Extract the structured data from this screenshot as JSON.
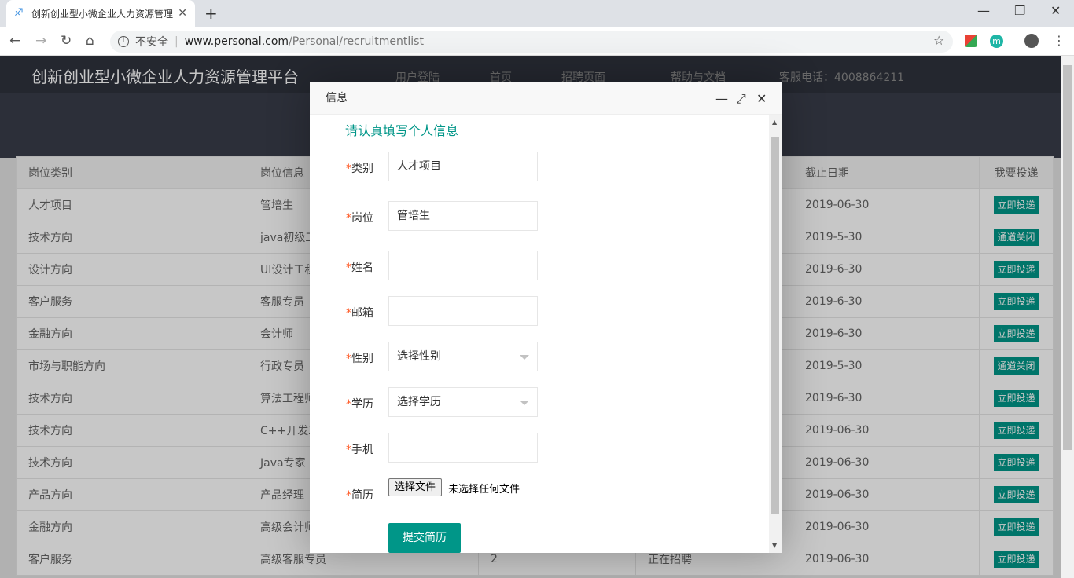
{
  "browser": {
    "tab_title": "创新创业型小微企业人力资源管理",
    "insecure_label": "不安全",
    "url_host": "www.personal.com",
    "url_path": "/Personal/recruitmentlist"
  },
  "site": {
    "brand": "创新创业型小微企业人力资源管理平台",
    "nav": [
      "用户登陆",
      "首页",
      "招聘页面",
      "帮助与文档",
      "客服电话：4008864211"
    ]
  },
  "table": {
    "headers": [
      "岗位类别",
      "岗位信息",
      "",
      "",
      "截止日期",
      "我要投递"
    ],
    "rows": [
      {
        "category": "人才项目",
        "position": "管培生",
        "count": "",
        "status": "",
        "deadline": "2019-06-30",
        "action": "立即投递"
      },
      {
        "category": "技术方向",
        "position": "java初级工",
        "count": "",
        "status": "",
        "deadline": "2019-5-30",
        "action": "通道关闭"
      },
      {
        "category": "设计方向",
        "position": "UI设计工程",
        "count": "",
        "status": "",
        "deadline": "2019-6-30",
        "action": "立即投递"
      },
      {
        "category": "客户服务",
        "position": "客服专员",
        "count": "",
        "status": "",
        "deadline": "2019-6-30",
        "action": "立即投递"
      },
      {
        "category": "金融方向",
        "position": "会计师",
        "count": "",
        "status": "",
        "deadline": "2019-6-30",
        "action": "立即投递"
      },
      {
        "category": "市场与职能方向",
        "position": "行政专员",
        "count": "",
        "status": "",
        "deadline": "2019-5-30",
        "action": "通道关闭"
      },
      {
        "category": "技术方向",
        "position": "算法工程师",
        "count": "",
        "status": "",
        "deadline": "2019-6-30",
        "action": "立即投递"
      },
      {
        "category": "技术方向",
        "position": "C++开发工",
        "count": "",
        "status": "",
        "deadline": "2019-06-30",
        "action": "立即投递"
      },
      {
        "category": "技术方向",
        "position": "Java专家",
        "count": "",
        "status": "",
        "deadline": "2019-06-30",
        "action": "立即投递"
      },
      {
        "category": "产品方向",
        "position": "产品经理",
        "count": "",
        "status": "",
        "deadline": "2019-06-30",
        "action": "立即投递"
      },
      {
        "category": "金融方向",
        "position": "高级会计师",
        "count": "",
        "status": "",
        "deadline": "2019-06-30",
        "action": "立即投递"
      },
      {
        "category": "客户服务",
        "position": "高级客服专员",
        "count": "2",
        "status": "正在招聘",
        "deadline": "2019-06-30",
        "action": "立即投递"
      }
    ]
  },
  "modal": {
    "title": "信息",
    "form_title": "请认真填写个人信息",
    "fields": {
      "category": {
        "label": "类别",
        "value": "人才项目"
      },
      "position": {
        "label": "岗位",
        "value": "管培生"
      },
      "name": {
        "label": "姓名",
        "value": ""
      },
      "email": {
        "label": "邮箱",
        "value": ""
      },
      "gender": {
        "label": "性别",
        "value": "选择性别"
      },
      "education": {
        "label": "学历",
        "value": "选择学历"
      },
      "phone": {
        "label": "手机",
        "value": ""
      },
      "resume": {
        "label": "简历",
        "button": "选择文件",
        "status": "未选择任何文件"
      }
    },
    "submit": "提交简历"
  },
  "colors": {
    "accent": "#009688",
    "header": "#2f333d",
    "band": "#393d49",
    "required": "#ff5722"
  }
}
